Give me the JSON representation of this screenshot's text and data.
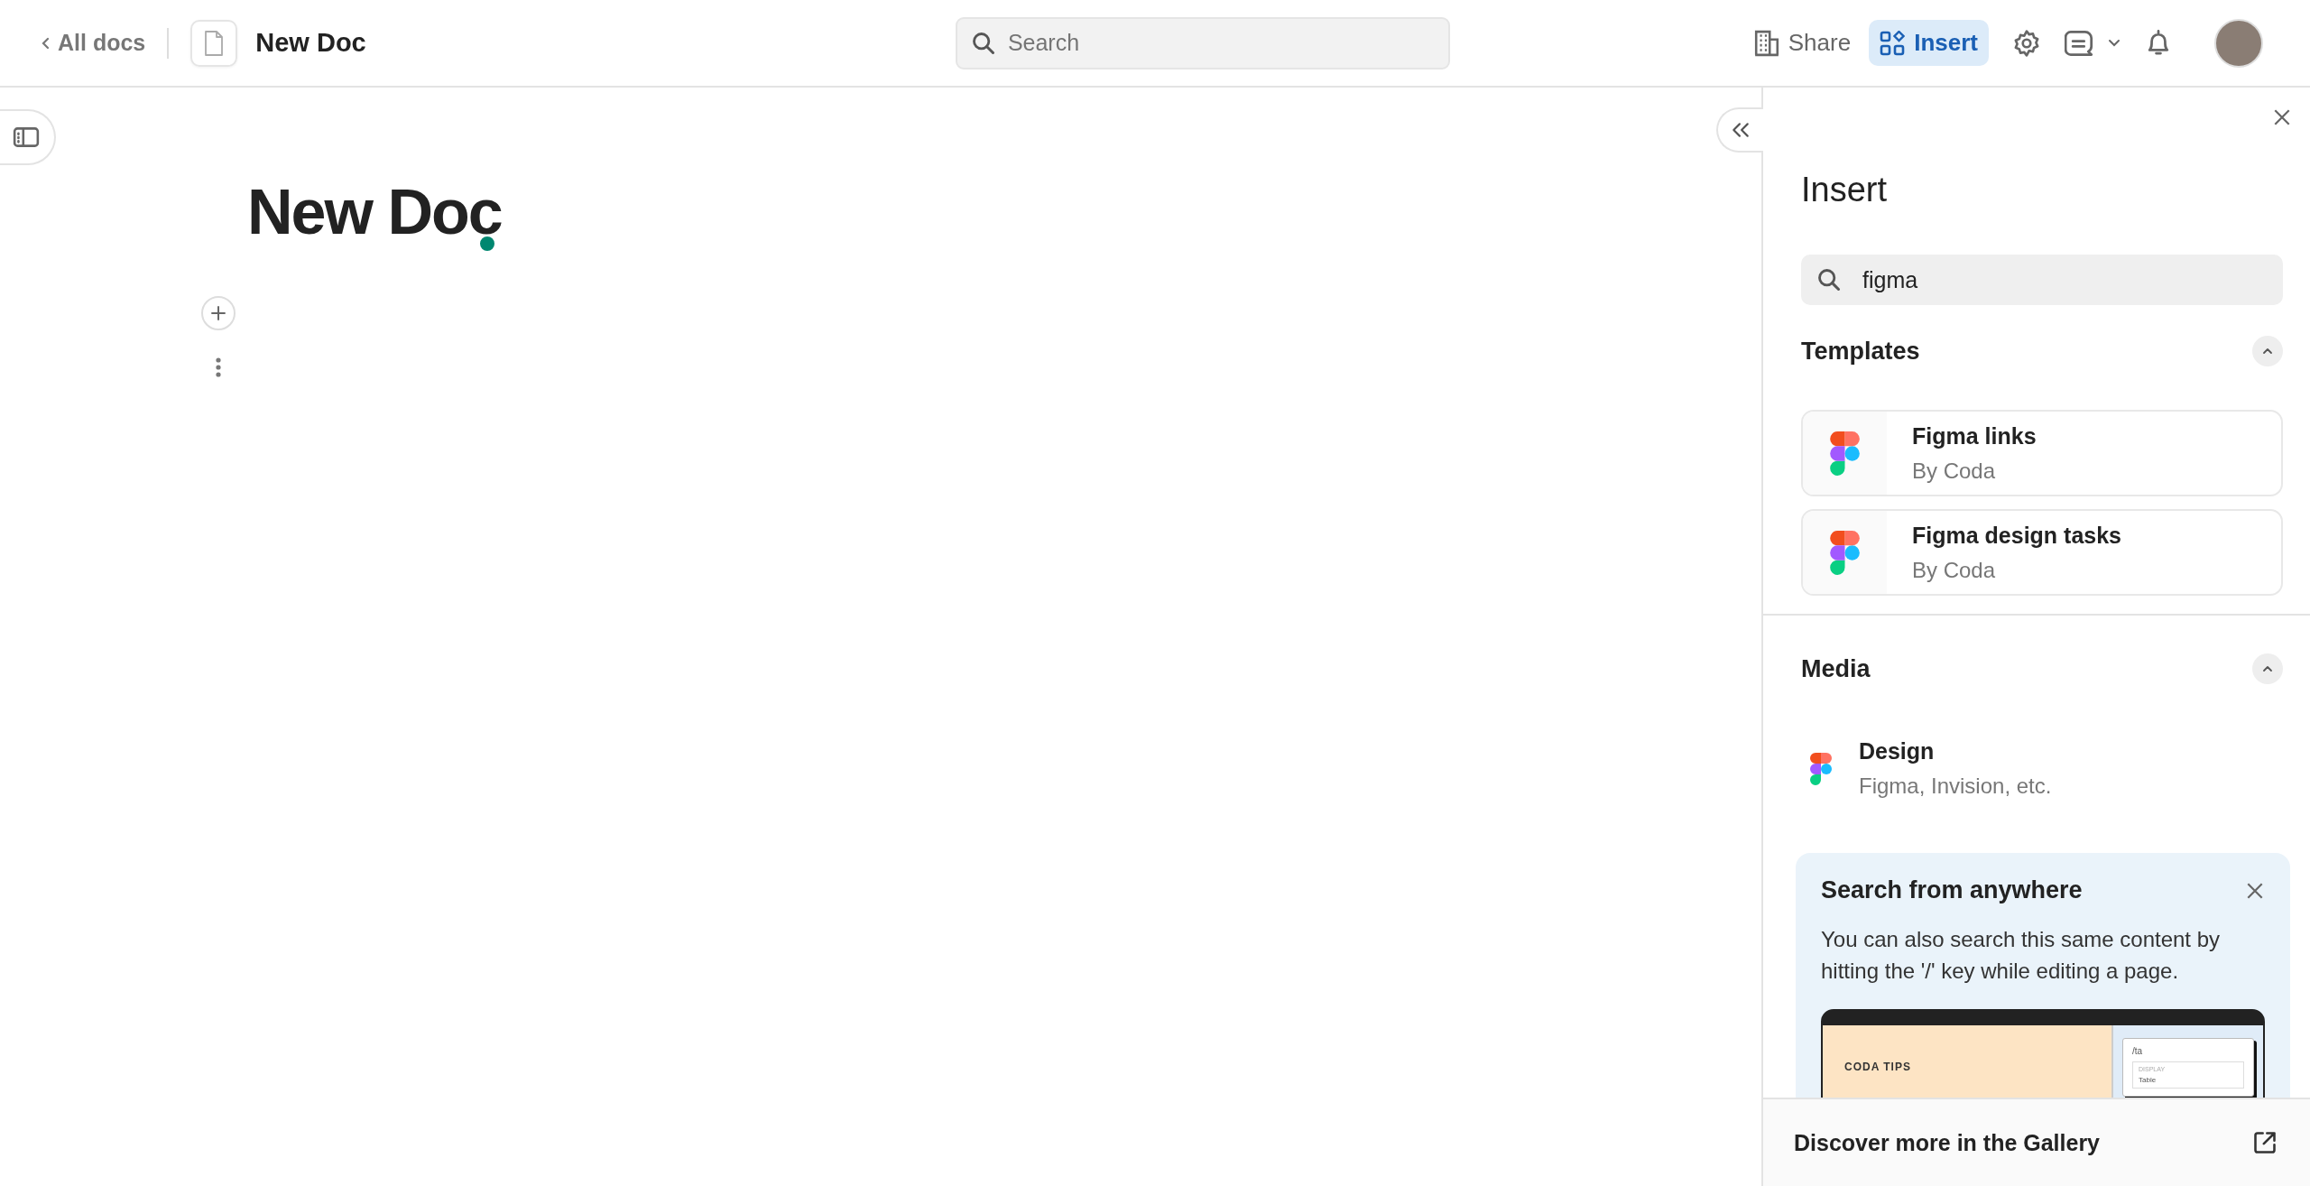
{
  "header": {
    "back_link": "All docs",
    "doc_title": "New Doc",
    "search": {
      "placeholder": "Search"
    },
    "share": "Share",
    "insert": {
      "label": "Insert",
      "selected": true
    }
  },
  "doc": {
    "title": "New Doc"
  },
  "panel": {
    "title": "Insert",
    "search": {
      "value": "figma"
    },
    "sections": [
      {
        "title": "Templates",
        "expanded": true,
        "kind": "cards",
        "items": [
          {
            "title": "Figma links",
            "subtitle": "By Coda"
          },
          {
            "title": "Figma design tasks",
            "subtitle": "By Coda"
          }
        ]
      },
      {
        "title": "Media",
        "expanded": true,
        "kind": "list",
        "items": [
          {
            "title": "Design",
            "subtitle": "Figma, Invision, etc."
          }
        ]
      }
    ],
    "tip": {
      "title": "Search from anywhere",
      "text": "You can also search this same content by hitting the '/' key while editing a page.",
      "preview": {
        "label": "CODA TIPS",
        "query": "/ta",
        "group": "DISPLAY",
        "option": "Table"
      }
    },
    "footer": "Discover more in the Gallery"
  }
}
